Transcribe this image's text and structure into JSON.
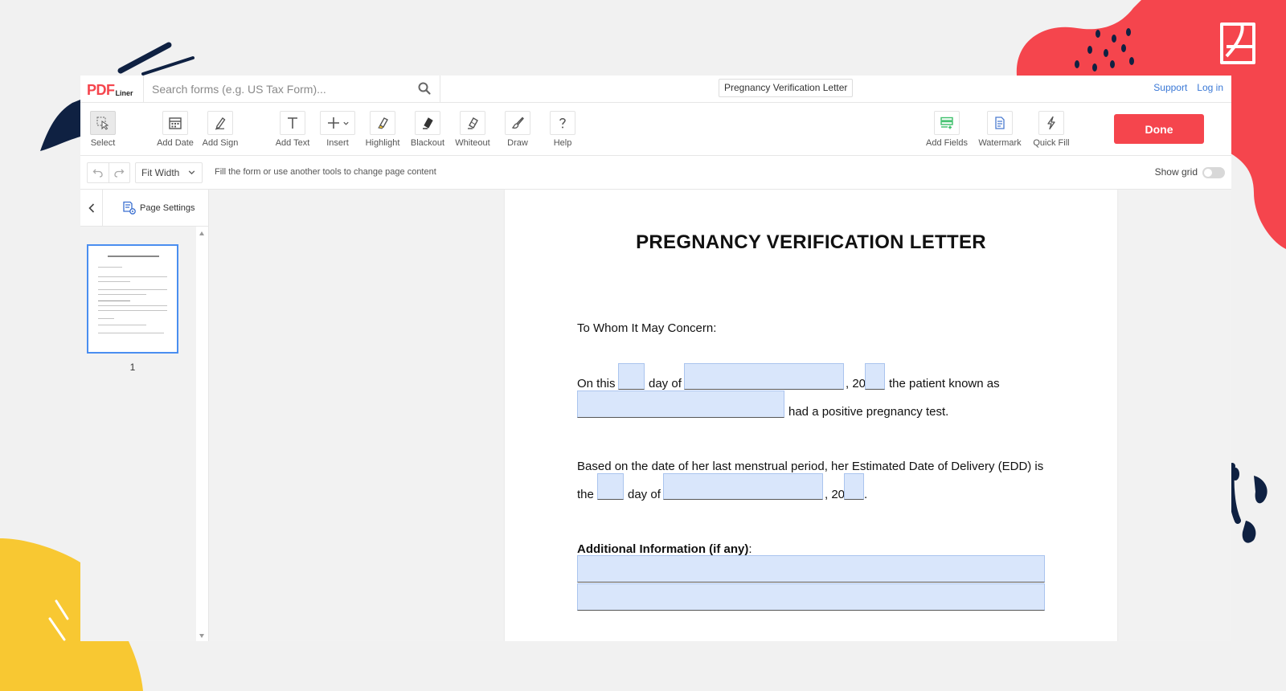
{
  "app": {
    "logo_main": "PDF",
    "logo_sub": "Liner",
    "search_placeholder": "Search forms (e.g. US Tax Form)...",
    "document_title": "Pregnancy Verification Letter",
    "support_link": "Support",
    "login_link": "Log in"
  },
  "toolbar": {
    "tools": [
      {
        "label": "Select",
        "icon": "cursor-icon"
      },
      {
        "label": "Add Date",
        "icon": "calendar-icon"
      },
      {
        "label": "Add Sign",
        "icon": "pen-sign-icon"
      },
      {
        "label": "Add Text",
        "icon": "text-icon"
      },
      {
        "label": "Insert",
        "icon": "plus-icon"
      },
      {
        "label": "Highlight",
        "icon": "highlighter-icon"
      },
      {
        "label": "Blackout",
        "icon": "blackout-icon"
      },
      {
        "label": "Whiteout",
        "icon": "eraser-icon"
      },
      {
        "label": "Draw",
        "icon": "brush-icon"
      },
      {
        "label": "Help",
        "icon": "question-icon"
      }
    ],
    "right_tools": [
      {
        "label": "Add Fields",
        "icon": "fields-icon"
      },
      {
        "label": "Watermark",
        "icon": "watermark-icon"
      },
      {
        "label": "Quick Fill",
        "icon": "lightning-icon"
      }
    ],
    "done_label": "Done"
  },
  "subbar": {
    "zoom": "Fit Width",
    "hint": "Fill the form or use another tools to change page content",
    "show_grid_label": "Show grid"
  },
  "sidebar": {
    "page_settings_label": "Page Settings",
    "page_number": "1"
  },
  "document": {
    "title": "PREGNANCY VERIFICATION LETTER",
    "salutation": "To Whom It May Concern:",
    "p1_on_this": "On this",
    "p1_day_of": "day of",
    "p1_year": ", 20",
    "p1_patient": "the patient known as",
    "p1_positive": "had a positive pregnancy test.",
    "p2_line1": "Based on the date of her last menstrual period, her Estimated Date of Delivery (EDD) is",
    "p2_the": "the",
    "p2_day_of": "day of",
    "p2_year": ", 20",
    "p2_end": ".",
    "additional_label": "Additional Information (if any)",
    "additional_colon": ":"
  },
  "colors": {
    "brand_red": "#f5454d",
    "field_fill": "#d9e6fb",
    "link_blue": "#3a78d6"
  }
}
